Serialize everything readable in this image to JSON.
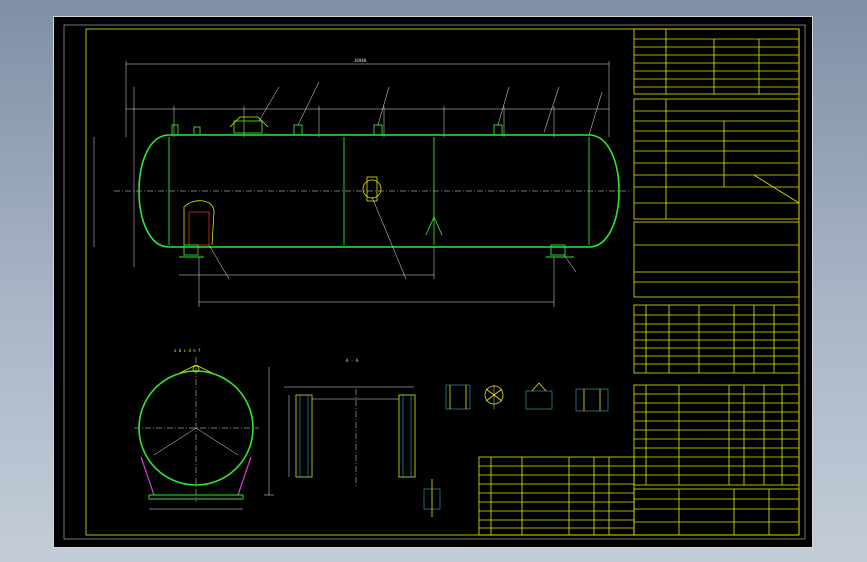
{
  "drawing": {
    "overall_length": "16940",
    "section_label": "A - A",
    "nozzle_letters": "a b c d e f"
  },
  "colors": {
    "background": "#000000",
    "frame": "#e6e600",
    "vessel": "#2ee82e",
    "dimension": "#eaeaea",
    "hatch": "#36d0e0",
    "support": "#d040d0"
  }
}
